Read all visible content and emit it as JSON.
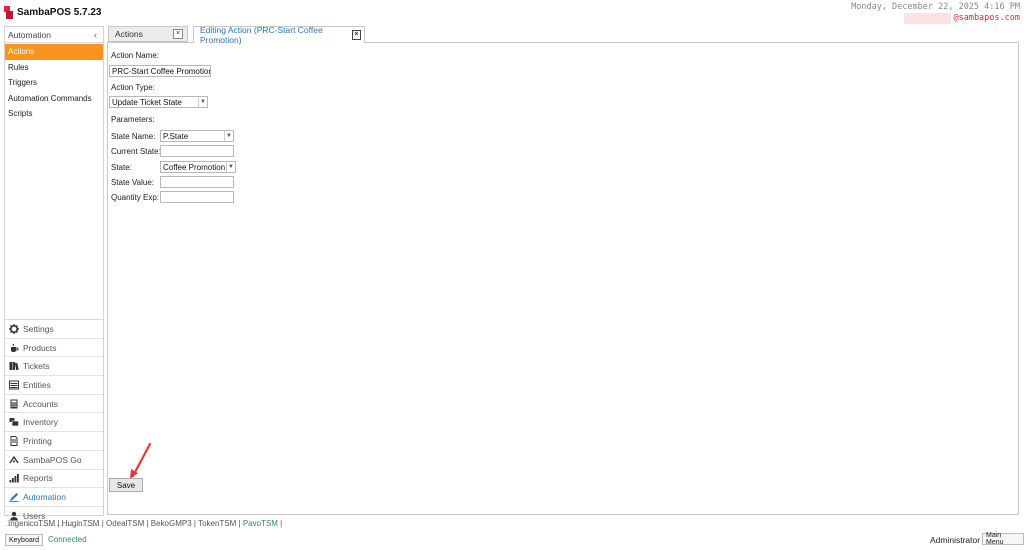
{
  "app": {
    "title": "SambaPOS 5.7.23"
  },
  "header": {
    "datetime": "Monday, December 22, 2025 4:16 PM",
    "user_handle": "@sambapos.com"
  },
  "sidebar": {
    "section_title": "Automation",
    "items": [
      {
        "label": "Actions",
        "active": true
      },
      {
        "label": "Rules"
      },
      {
        "label": "Triggers"
      },
      {
        "label": "Automation Commands"
      },
      {
        "label": "Scripts"
      }
    ]
  },
  "modules": [
    {
      "label": "Settings",
      "icon": "gear-icon"
    },
    {
      "label": "Products",
      "icon": "coffee-icon"
    },
    {
      "label": "Tickets",
      "icon": "tickets-icon"
    },
    {
      "label": "Entities",
      "icon": "entities-icon"
    },
    {
      "label": "Accounts",
      "icon": "calculator-icon"
    },
    {
      "label": "Inventory",
      "icon": "inventory-icon"
    },
    {
      "label": "Printing",
      "icon": "printer-icon"
    },
    {
      "label": "SambaPOS Go",
      "icon": "go-icon"
    },
    {
      "label": "Reports",
      "icon": "bar-chart-icon"
    },
    {
      "label": "Automation",
      "icon": "automation-icon",
      "active": true
    },
    {
      "label": "Users",
      "icon": "user-icon"
    }
  ],
  "tabs": [
    {
      "label": "Actions"
    },
    {
      "label": "Editing Action (PRC-Start Coffee Promotion)",
      "active": true
    }
  ],
  "form": {
    "action_name_label": "Action Name:",
    "action_name_value": "PRC-Start Coffee Promotion",
    "action_type_label": "Action Type:",
    "action_type_value": "Update Ticket State",
    "parameters_label": "Parameters:",
    "params": {
      "state_name": {
        "label": "State Name:",
        "value": "P.State"
      },
      "current_state": {
        "label": "Current State:",
        "value": ""
      },
      "state": {
        "label": "State:",
        "value": "Coffee Promotion"
      },
      "state_value": {
        "label": "State Value:",
        "value": ""
      },
      "quantity_exp": {
        "label": "Quantity Exp:",
        "value": ""
      }
    },
    "save_label": "Save"
  },
  "footer": {
    "devices": [
      "IngenicoTSM",
      "HuginTSM",
      "OdealTSM",
      "BekoGMP3",
      "TokenTSM"
    ],
    "active_device": "PavoTSM",
    "keyboard_label": "Keyboard",
    "status": "Connected",
    "user": "Administrator",
    "main_menu_label": "Main Menu"
  },
  "colors": {
    "accent": "#f7941d",
    "link": "#2b73c2",
    "brand": "#e0263a",
    "status": "#2e8b57",
    "annotation_arrow": "#e53935"
  }
}
